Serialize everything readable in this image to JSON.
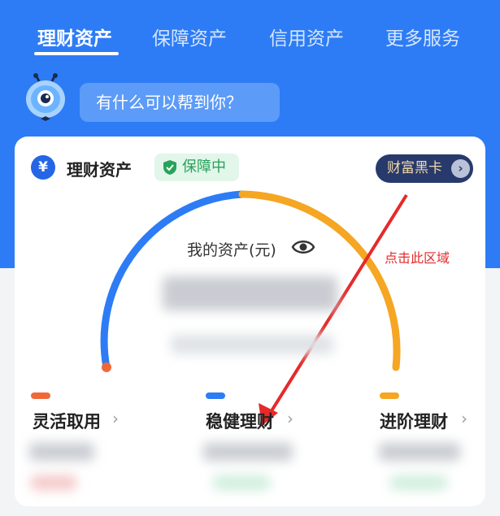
{
  "tabs": [
    {
      "label": "理财资产",
      "active": true
    },
    {
      "label": "保障资产",
      "active": false
    },
    {
      "label": "信用资产",
      "active": false
    },
    {
      "label": "更多服务",
      "active": false
    }
  ],
  "assistant": {
    "prompt": "有什么可以帮到你？",
    "icon": "robot-mascot-icon"
  },
  "card": {
    "icon_glyph": "¥",
    "title": "理财资产",
    "badge": "保障中",
    "vip_label": "财富黑卡",
    "vip_arrow": "›",
    "asset_label": "我的资产(元)",
    "categories": [
      {
        "label": "灵活取用",
        "color": "#f0683a",
        "chevron": "›"
      },
      {
        "label": "稳健理财",
        "color": "#2d7cf5",
        "chevron": "›"
      },
      {
        "label": "进阶理财",
        "color": "#f5a623",
        "chevron": "›"
      }
    ]
  },
  "annotation": {
    "text": "点击此区域",
    "color": "#e52a2a"
  },
  "colors": {
    "brand_blue": "#2d7cf5",
    "orange": "#f5a623",
    "red_dot": "#f0683a"
  }
}
